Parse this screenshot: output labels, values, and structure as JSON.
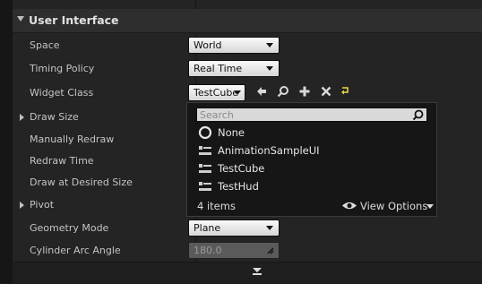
{
  "category": {
    "title": "User Interface"
  },
  "properties": [
    {
      "label": "Space",
      "value": "World"
    },
    {
      "label": "Timing Policy",
      "value": "Real Time"
    },
    {
      "label": "Widget Class",
      "value": "TestCube"
    },
    {
      "label": "Draw Size"
    },
    {
      "label": "Manually Redraw"
    },
    {
      "label": "Redraw Time"
    },
    {
      "label": "Draw at Desired Size"
    },
    {
      "label": "Pivot"
    },
    {
      "label": "Geometry Mode",
      "value": "Plane"
    },
    {
      "label": "Cylinder Arc Angle",
      "value": "180.0"
    }
  ],
  "widget_tools": [
    "arrow-left-icon",
    "magnifier-icon",
    "plus-icon",
    "clear-x-icon",
    "reset-arrow-icon"
  ],
  "picker": {
    "search_placeholder": "Search",
    "options": [
      {
        "label": "None",
        "icon": "circle-icon"
      },
      {
        "label": "AnimationSampleUI",
        "icon": "widget-class-icon"
      },
      {
        "label": "TestCube",
        "icon": "widget-class-icon"
      },
      {
        "label": "TestHud",
        "icon": "widget-class-icon"
      }
    ],
    "count": "4 items",
    "view_options": "View Options"
  },
  "colors": {
    "accent_reset": "#e8d44d",
    "panel": "#242424",
    "header": "#2e2e2e"
  }
}
